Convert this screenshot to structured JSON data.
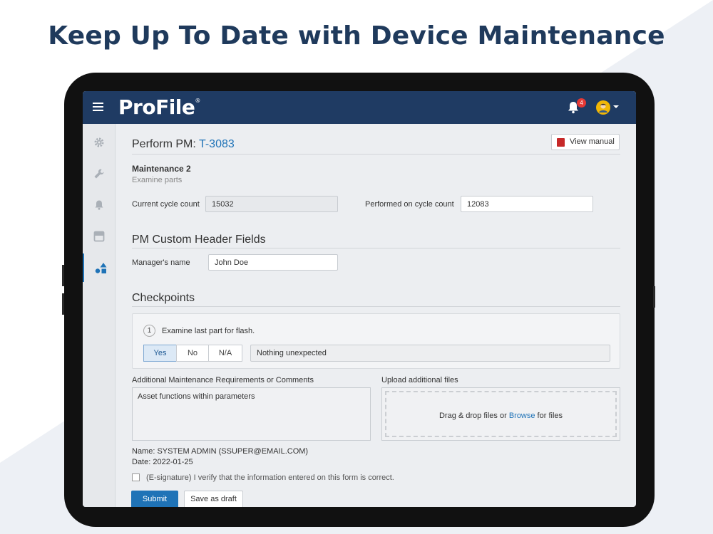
{
  "headline": "Keep Up To Date with Device Maintenance",
  "app": {
    "logo": "ProFile",
    "logo_mark": "®",
    "notification_count": "4",
    "colors": {
      "topbar": "#1f3b63",
      "accent": "#1f73b7",
      "badge": "#e53935"
    }
  },
  "sidebar": {
    "items": [
      {
        "icon": "gear-icon"
      },
      {
        "icon": "wrench-icon"
      },
      {
        "icon": "bell-icon"
      },
      {
        "icon": "panel-icon"
      },
      {
        "icon": "shapes-icon",
        "active": true
      }
    ]
  },
  "header": {
    "title_prefix": "Perform PM: ",
    "title_link": "T-3083",
    "view_manual": "View manual"
  },
  "maintenance": {
    "name": "Maintenance 2",
    "description": "Examine parts",
    "current_cycle_label": "Current cycle count",
    "current_cycle_value": "15032",
    "performed_cycle_label": "Performed on cycle count",
    "performed_cycle_value": "12083"
  },
  "custom_fields": {
    "heading": "PM Custom Header Fields",
    "manager_label": "Manager's name",
    "manager_value": "John Doe"
  },
  "checkpoints": {
    "heading": "Checkpoints",
    "items": [
      {
        "number": "1",
        "text": "Examine last part for flash.",
        "options": [
          "Yes",
          "No",
          "N/A"
        ],
        "selected": "Yes",
        "note": "Nothing unexpected"
      }
    ]
  },
  "comments": {
    "label": "Additional Maintenance Requirements or Comments",
    "value": "Asset functions within parameters"
  },
  "upload": {
    "label": "Upload additional files",
    "text_before": "Drag & drop files or ",
    "browse": "Browse",
    "text_after": " for files"
  },
  "signature": {
    "name_line": "Name: SYSTEM ADMIN (SSUPER@EMAIL.COM)",
    "date_line": "Date: 2022-01-25",
    "esign_text": "(E-signature) I verify that the information entered on this form is correct."
  },
  "actions": {
    "submit": "Submit",
    "save_draft": "Save as draft"
  }
}
